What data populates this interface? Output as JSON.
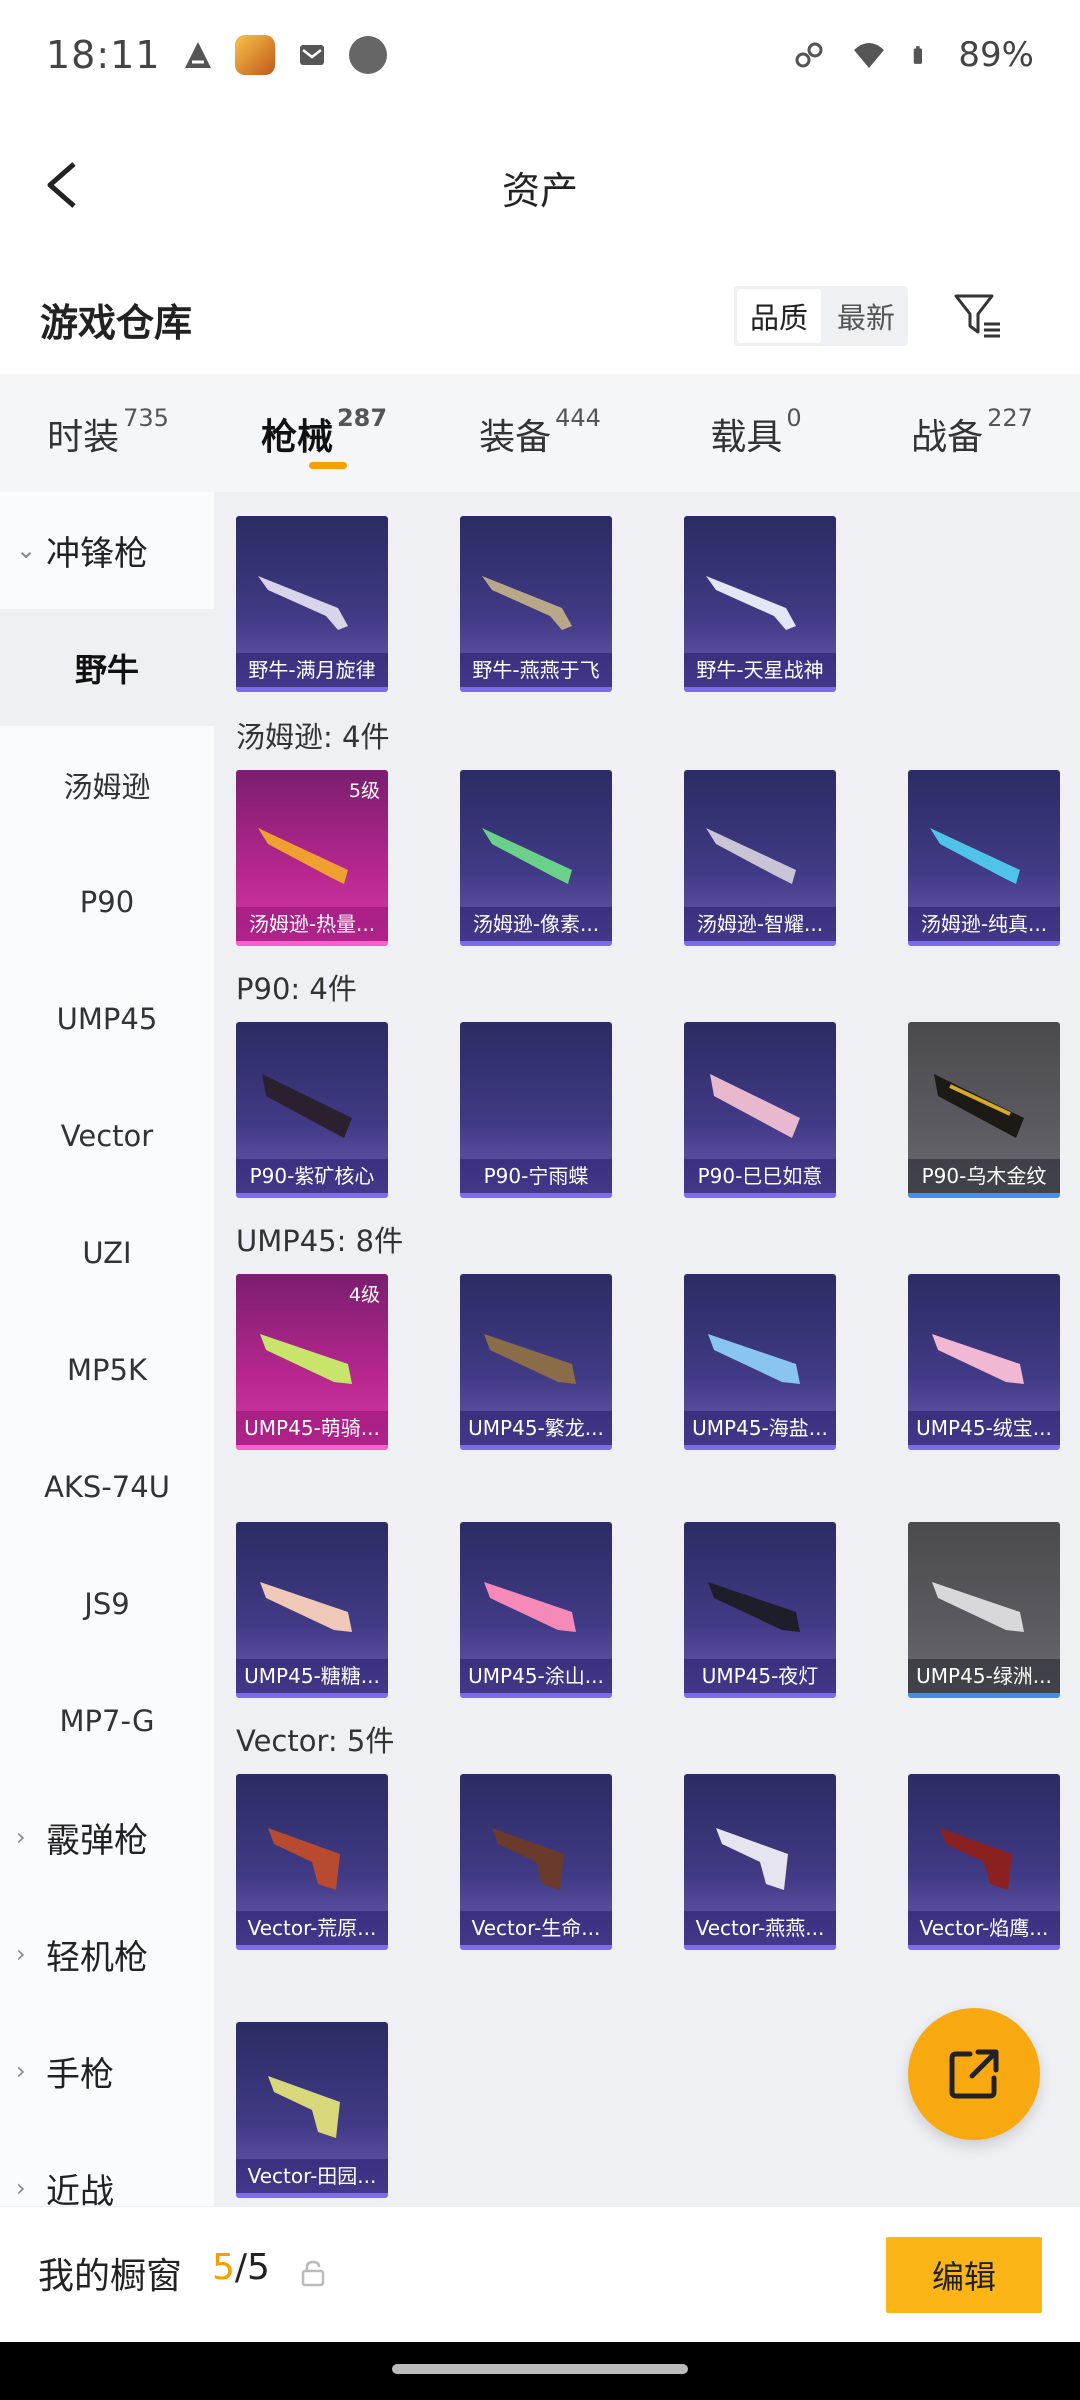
{
  "status_bar": {
    "time": "18:11",
    "battery": "89%"
  },
  "header": {
    "title": "资产"
  },
  "store": {
    "title": "游戏仓库",
    "sort_quality": "品质",
    "sort_latest": "最新"
  },
  "tabs": [
    {
      "label": "时装",
      "count": "735"
    },
    {
      "label": "枪械",
      "count": "287"
    },
    {
      "label": "装备",
      "count": "444"
    },
    {
      "label": "载具",
      "count": "0"
    },
    {
      "label": "战备",
      "count": "227"
    }
  ],
  "sidebar": {
    "items": [
      {
        "label": "冲锋枪",
        "kind": "category-open"
      },
      {
        "label": "野牛",
        "kind": "active"
      },
      {
        "label": "汤姆逊",
        "kind": "item"
      },
      {
        "label": "P90",
        "kind": "item"
      },
      {
        "label": "UMP45",
        "kind": "item"
      },
      {
        "label": "Vector",
        "kind": "item"
      },
      {
        "label": "UZI",
        "kind": "item"
      },
      {
        "label": "MP5K",
        "kind": "item"
      },
      {
        "label": "AKS-74U",
        "kind": "item"
      },
      {
        "label": "JS9",
        "kind": "item"
      },
      {
        "label": "MP7-G",
        "kind": "item"
      },
      {
        "label": "霰弹枪",
        "kind": "category"
      },
      {
        "label": "轻机枪",
        "kind": "category"
      },
      {
        "label": "手枪",
        "kind": "category"
      },
      {
        "label": "近战",
        "kind": "category"
      }
    ]
  },
  "groups": {
    "thompson": "汤姆逊: 4件",
    "p90": "P90: 4件",
    "ump45": "UMP45: 8件",
    "vector": "Vector: 5件"
  },
  "cards": {
    "bison": [
      "野牛-满月旋律",
      "野牛-燕燕于飞",
      "野牛-天星战神"
    ],
    "thompson": [
      "汤姆逊-热量...",
      "汤姆逊-像素...",
      "汤姆逊-智耀...",
      "汤姆逊-纯真..."
    ],
    "thompson_level": "5级",
    "p90": [
      "P90-紫矿核心",
      "P90-宁雨蝶",
      "P90-巳巳如意",
      "P90-乌木金纹"
    ],
    "ump45_a": [
      "UMP45-萌骑...",
      "UMP45-繁龙...",
      "UMP45-海盐...",
      "UMP45-绒宝..."
    ],
    "ump45_level": "4级",
    "ump45_b": [
      "UMP45-糖糖...",
      "UMP45-涂山...",
      "UMP45-夜灯",
      "UMP45-绿洲..."
    ],
    "vector": [
      "Vector-荒原...",
      "Vector-生命...",
      "Vector-燕燕...",
      "Vector-焰鹰...",
      "Vector-田园..."
    ]
  },
  "bottom": {
    "label": "我的橱窗",
    "count_current": "5",
    "count_total": "/5",
    "edit": "编辑"
  },
  "colors": {
    "accent": "#f5a000",
    "edit_button": "#fbb516",
    "card_purple": "#413a86",
    "card_pink": "#b8278f",
    "card_gray": "#5a5a60"
  }
}
